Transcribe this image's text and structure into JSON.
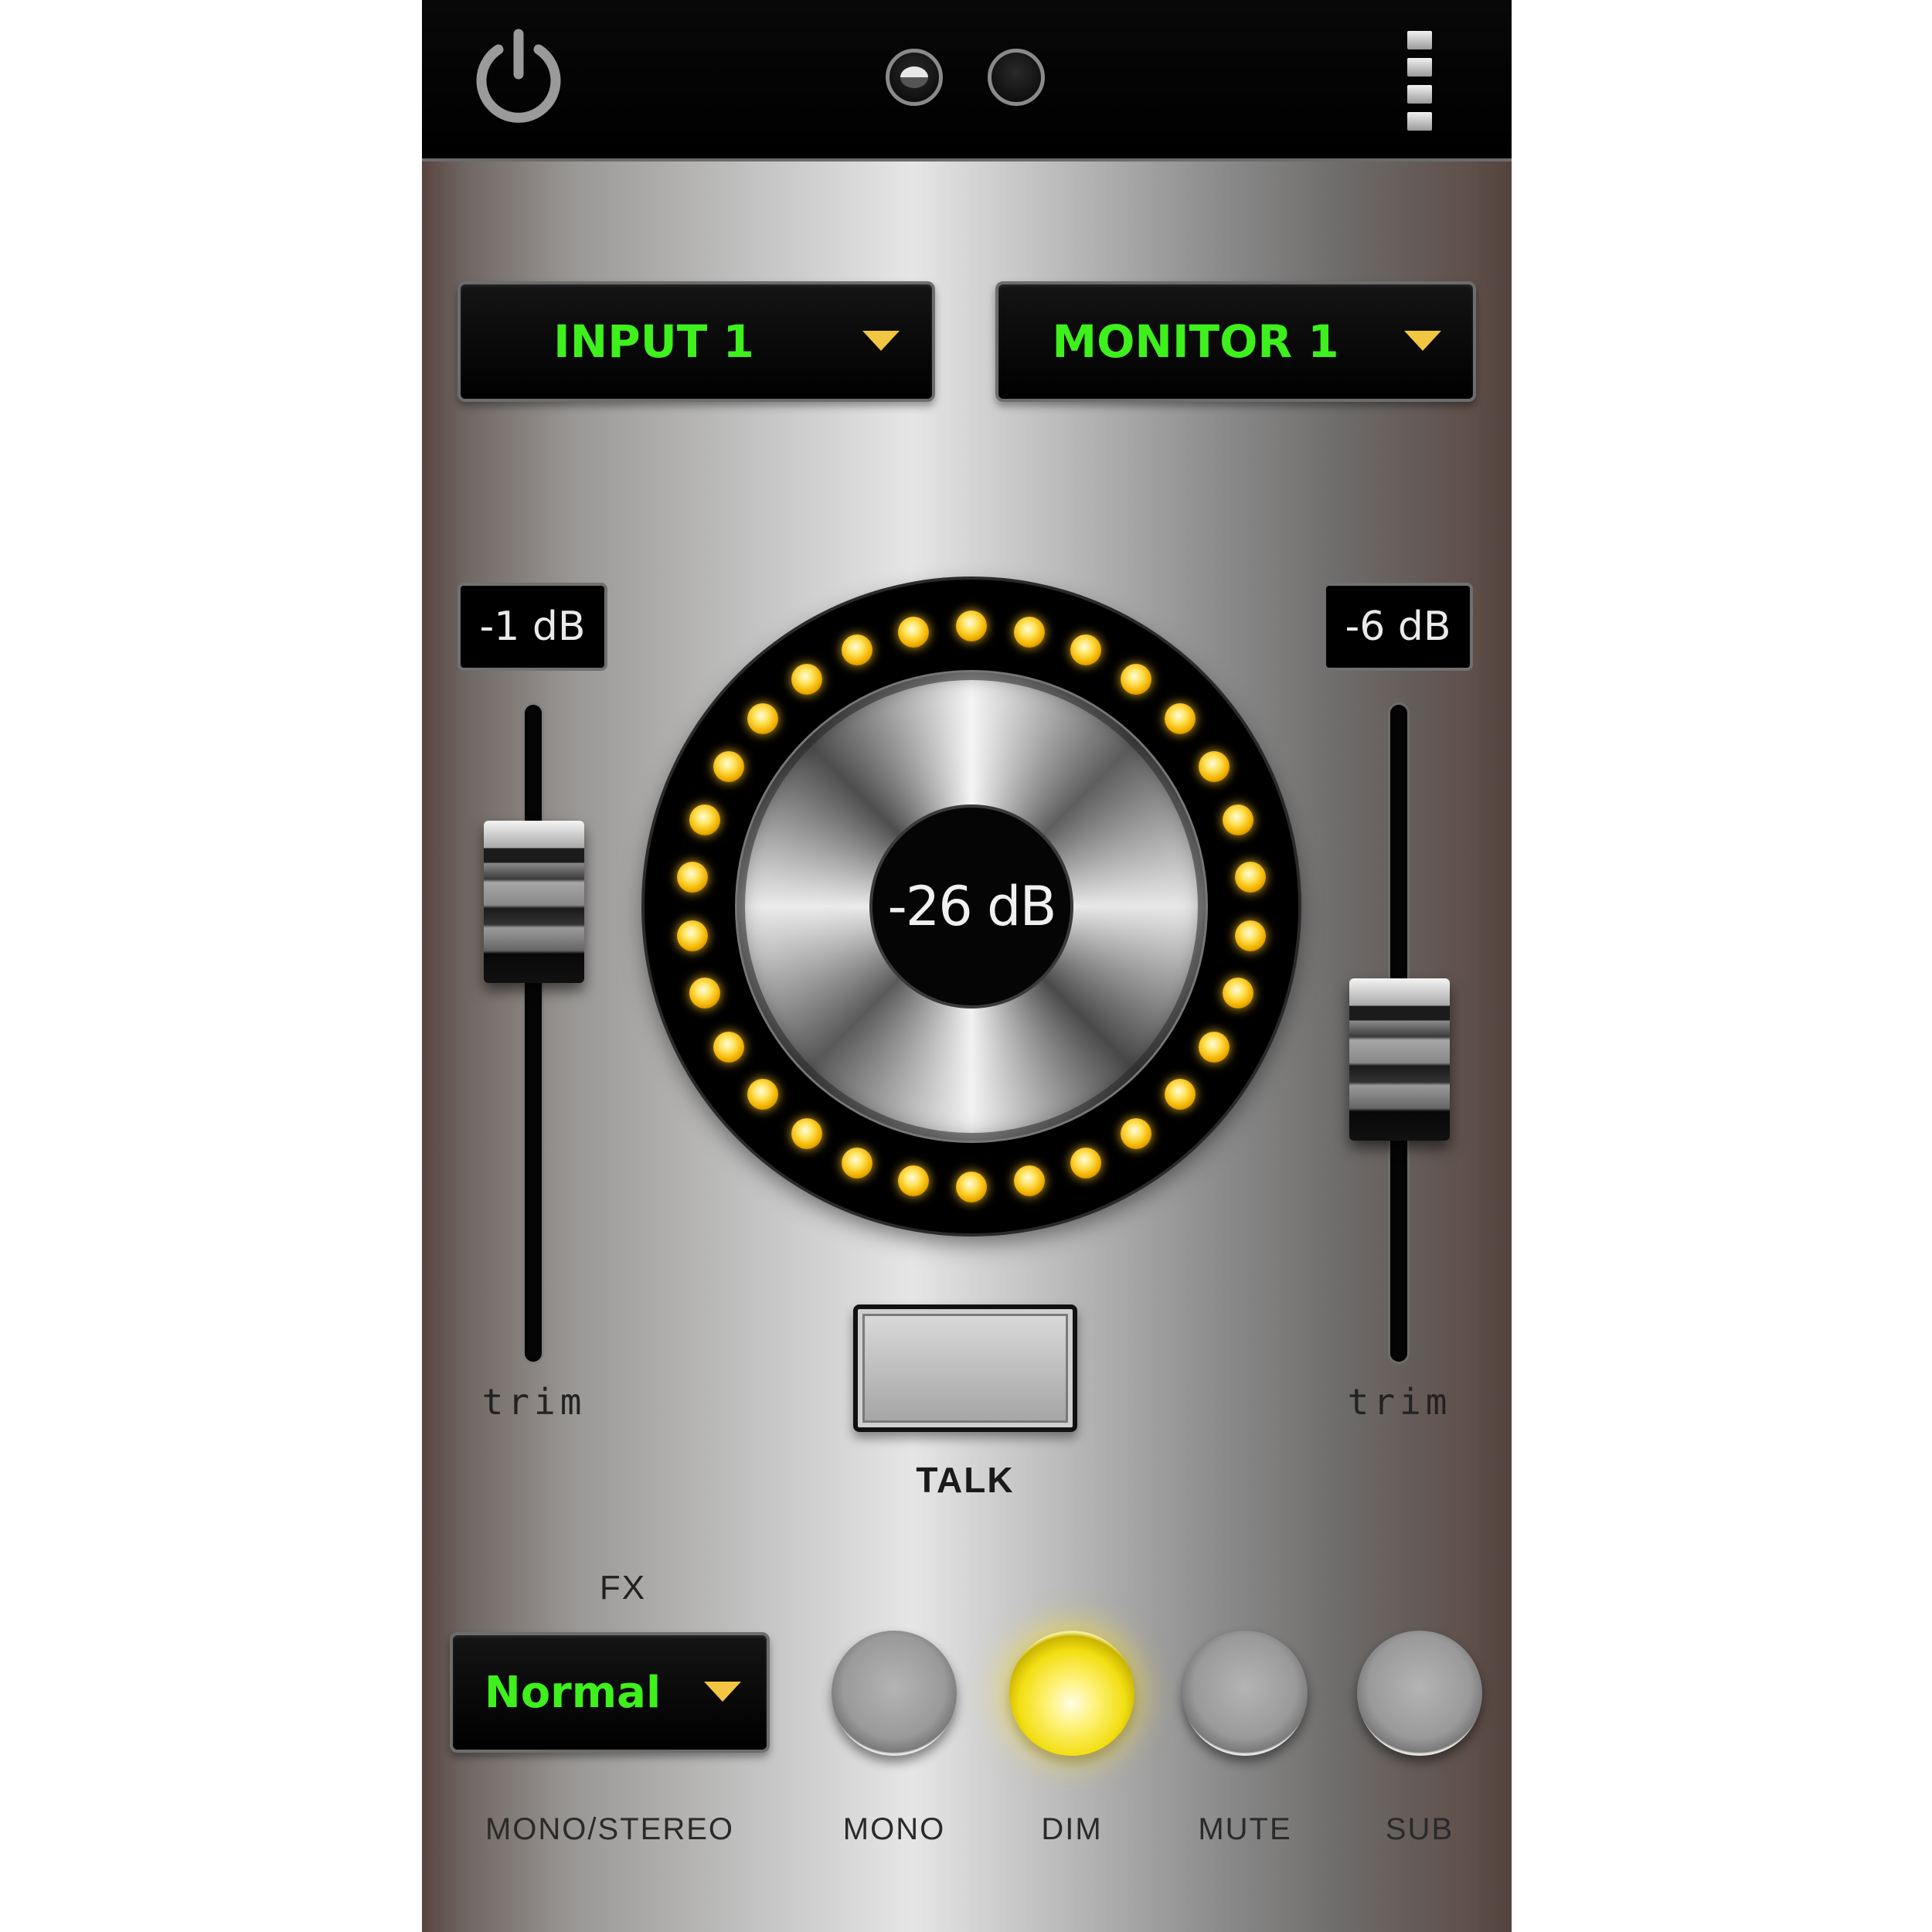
{
  "colors": {
    "display_text": "#3ef01c",
    "led": "#f4b400",
    "active_button": "#f2df12",
    "caret": "#f2c542"
  },
  "header": {
    "icons": [
      "power-icon",
      "page-indicator",
      "menu-icon"
    ],
    "active_page": 1,
    "page_count": 2
  },
  "selectors": {
    "input": "INPUT 1",
    "monitor": "MONITOR 1"
  },
  "trim_left": {
    "value": "-1 dB",
    "label": "trim",
    "position": 0.25
  },
  "trim_right": {
    "value": "-6 dB",
    "label": "trim",
    "position": 0.55
  },
  "volume": {
    "value": "-26 dB",
    "led_count": 30,
    "leds_lit": 30
  },
  "talk": {
    "label": "TALK"
  },
  "fx": {
    "label": "FX",
    "value": "Normal",
    "caption": "MONO/STEREO"
  },
  "buttons": [
    {
      "caption": "MONO",
      "active": false
    },
    {
      "caption": "DIM",
      "active": true
    },
    {
      "caption": "MUTE",
      "active": false
    },
    {
      "caption": "SUB",
      "active": false
    }
  ]
}
